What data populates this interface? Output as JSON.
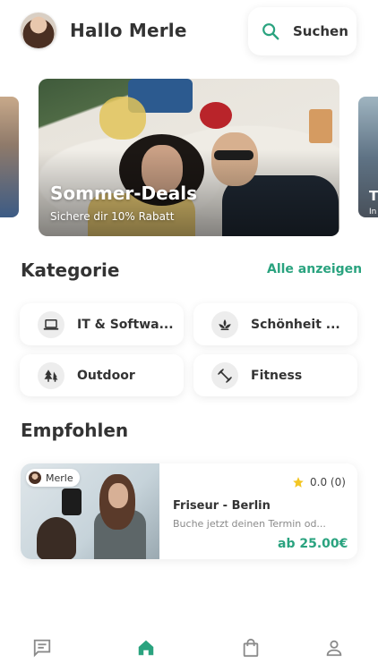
{
  "header": {
    "greeting": "Hallo Merle",
    "search_label": "Suchen"
  },
  "colors": {
    "accent": "#2aa37f",
    "text": "#333333",
    "muted": "#8a8a8a",
    "star": "#f3c623"
  },
  "carousel": {
    "banner": {
      "title": "Sommer-Deals",
      "subtitle": "Sichere dir 10% Rabatt"
    },
    "next_card_partial": {
      "title": "T",
      "subtitle": "In"
    }
  },
  "categories": {
    "title": "Kategorie",
    "see_all": "Alle anzeigen",
    "items": [
      {
        "label": "IT & Softwa...",
        "icon": "laptop-icon"
      },
      {
        "label": "Schönheit ...",
        "icon": "lotus-icon"
      },
      {
        "label": "Outdoor",
        "icon": "trees-icon"
      },
      {
        "label": "Fitness",
        "icon": "dumbbell-icon"
      }
    ]
  },
  "recommended": {
    "title": "Empfohlen",
    "items": [
      {
        "provider": "Merle",
        "rating": "0.0 (0)",
        "title": "Friseur - Berlin",
        "description": "Buche jetzt deinen Termin od...",
        "price": "ab 25.00€"
      }
    ]
  },
  "tabbar": {
    "items": [
      {
        "icon": "chat-icon",
        "active": false
      },
      {
        "icon": "home-icon",
        "active": true
      },
      {
        "icon": "shopping-bag-icon",
        "active": false
      },
      {
        "icon": "person-icon",
        "active": false
      }
    ]
  }
}
